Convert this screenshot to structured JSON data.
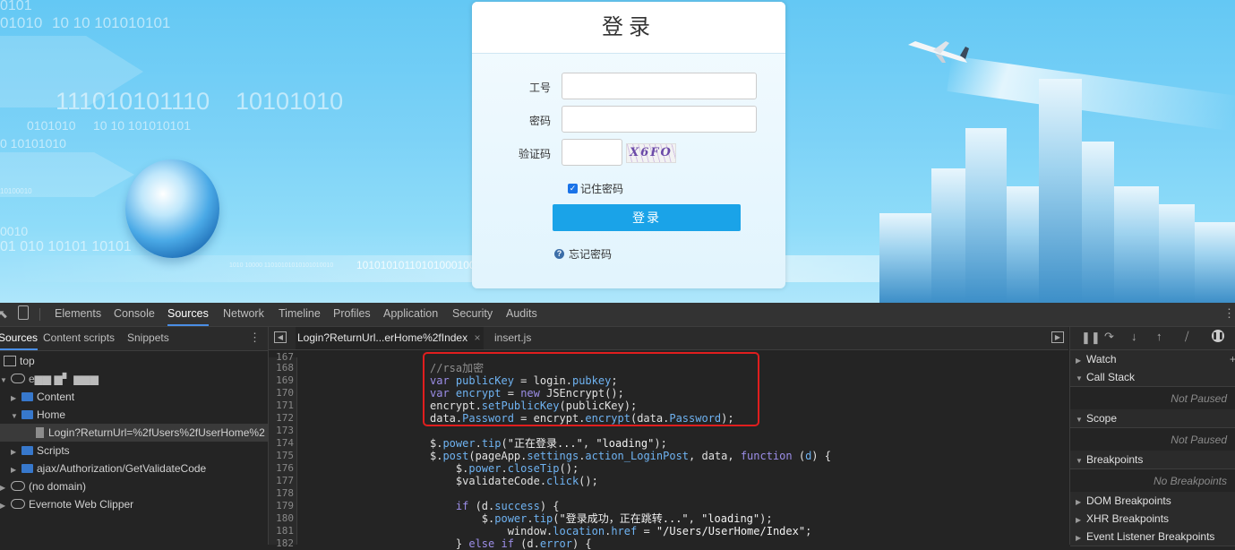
{
  "site": {
    "binary_texts": [
      "0101",
      "01010",
      "10 10 101010101",
      "111010101110",
      "10101010",
      "0101010",
      "10 10 101010101",
      "0 10101010",
      "10100010",
      "0010",
      "01 010 10101 10101",
      "1010 10000 11010101010101010010",
      "101010101101010001000101"
    ],
    "login": {
      "title": "登录",
      "user_label": "工号",
      "user_value": "",
      "pwd_label": "密码",
      "pwd_value": "",
      "captcha_label": "验证码",
      "captcha_value": "",
      "captcha_text": "X6FO",
      "remember_label": "记住密码",
      "remember_checked": true,
      "submit_label": "登录",
      "forgot_label": "忘记密码"
    }
  },
  "devtools": {
    "tabs": [
      "Elements",
      "Console",
      "Sources",
      "Network",
      "Timeline",
      "Profiles",
      "Application",
      "Security",
      "Audits"
    ],
    "active_tab": "Sources",
    "left_tabs": [
      "Sources",
      "Content scripts",
      "Snippets"
    ],
    "tree": {
      "top": "top",
      "domain_masked": "e▆▆  ▆▘  ▆▆▆",
      "content": "Content",
      "home": "Home",
      "login_file": "Login?ReturnUrl=%2fUsers%2fUserHome%2",
      "scripts": "Scripts",
      "ajax": "ajax/Authorization/GetValidateCode",
      "no_domain": "(no domain)",
      "evernote": "Evernote Web Clipper"
    },
    "file_tabs": [
      "Login?ReturnUrl...erHome%2fIndex",
      "insert.js"
    ],
    "file_close": "×",
    "line_numbers": [
      "167",
      "168",
      "169",
      "170",
      "171",
      "172",
      "173",
      "174",
      "175",
      "176",
      "177",
      "178",
      "179",
      "180",
      "181",
      "182"
    ],
    "right_sections": {
      "watch": "Watch",
      "call_stack": "Call Stack",
      "not_paused_1": "Not Paused",
      "scope": "Scope",
      "not_paused_2": "Not Paused",
      "breakpoints": "Breakpoints",
      "no_breakpoints": "No Breakpoints",
      "dom_breakpoints": "DOM Breakpoints",
      "xhr_breakpoints": "XHR Breakpoints",
      "event_breakpoints": "Event Listener Breakpoints"
    }
  }
}
